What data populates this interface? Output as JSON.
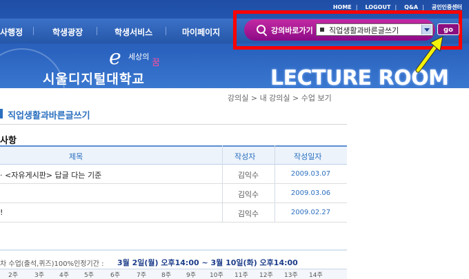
{
  "header": {
    "top_links": [
      "HOME",
      "LOGOUT",
      "Q&A",
      "공인인증센터"
    ],
    "menu": [
      "사행정",
      "학생광장",
      "학생서비스",
      "마이페이지"
    ],
    "logo_e": "e",
    "logo_small": "세상의",
    "logo_accent": "꿈",
    "logo_name": "시울디지털대학교",
    "banner": "LECTURE ROOM"
  },
  "search": {
    "label": "강의바로가기",
    "selected_course": "직업생활과바른글쓰기",
    "go_label": "go"
  },
  "breadcrumb": "강의실 > 내 강의실 > 수업 보기",
  "page_title": "직업생활과바른글쓰기",
  "notice": {
    "heading": "사항",
    "columns": [
      "제목",
      "작성자",
      "작성일자"
    ],
    "rows": [
      {
        "title": "· <자유게시판> 답글 다는 기준",
        "author": "김익수",
        "date": "2009.03.07"
      },
      {
        "title": "",
        "author": "김익수",
        "date": "2009.03.06"
      },
      {
        "title": "!",
        "author": "김익수",
        "date": "2009.02.27"
      }
    ]
  },
  "attendance": {
    "label": "차 수업(출석,퀴즈)100%인정기간 :",
    "period": "3월 2일(월) 오후14:00 ~ 3월 10일(화) 오후14:00",
    "weeks": [
      "2주",
      "3주",
      "4주",
      "5주",
      "6주",
      "7주",
      "8주",
      "9주",
      "10주",
      "11주",
      "12주",
      "13주",
      "14주"
    ]
  },
  "colors": {
    "header_blue": "#2657a8",
    "highlight_red": "#ff0000",
    "search_magenta": "#8d0a86",
    "accent_blue": "#2a6fbf",
    "arrow_yellow": "#f5f20a"
  }
}
